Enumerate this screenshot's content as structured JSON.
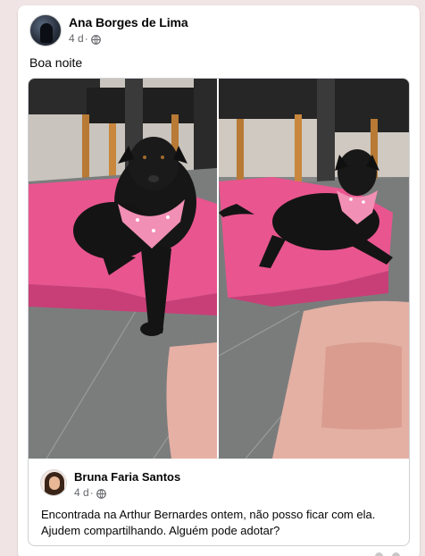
{
  "post": {
    "author": "Ana Borges de Lima",
    "time": "4 d",
    "separator": "·",
    "audience_icon": "globe-icon",
    "text": "Boa noite"
  },
  "shared_post": {
    "author": "Bruna Faria Santos",
    "time": "4 d",
    "separator": "·",
    "audience_icon": "globe-icon",
    "text": "Encontrada na Arthur Bernardes ontem, não posso ficar com ela. Ajudem compartilhando. Alguém pode adotar?"
  },
  "colors": {
    "page_background": "#f0e4e4",
    "card_background": "#ffffff",
    "meta_text": "#65676b",
    "bandana_pink": "#f28fb4",
    "blanket_pink": "#e9558f"
  }
}
